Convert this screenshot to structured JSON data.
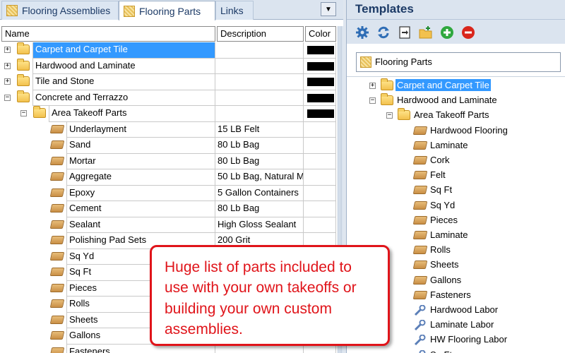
{
  "left_tabs": [
    {
      "label": "Flooring Assemblies",
      "icon": "flooring-pattern-icon"
    },
    {
      "label": "Flooring Parts",
      "icon": "flooring-pattern-icon",
      "active": true
    },
    {
      "label": "Links"
    }
  ],
  "grid": {
    "columns": [
      "Name",
      "Description",
      "Color"
    ],
    "rows": [
      {
        "name": "Carpet and Carpet Tile",
        "description": "",
        "color": "#000000",
        "level": 0,
        "type": "folder",
        "expander": "+",
        "selected": true
      },
      {
        "name": "Hardwood and Laminate",
        "description": "",
        "color": "#000000",
        "level": 0,
        "type": "folder",
        "expander": "+"
      },
      {
        "name": "Tile and Stone",
        "description": "",
        "color": "#000000",
        "level": 0,
        "type": "folder",
        "expander": "+"
      },
      {
        "name": "Concrete and Terrazzo",
        "description": "",
        "color": "#000000",
        "level": 0,
        "type": "folder",
        "expander": "−"
      },
      {
        "name": "Area Takeoff Parts",
        "description": "",
        "color": "#000000",
        "level": 1,
        "type": "folder",
        "expander": "−"
      },
      {
        "name": "Underlayment",
        "description": "15 LB Felt",
        "level": 2,
        "type": "part"
      },
      {
        "name": "Sand",
        "description": "80 Lb Bag",
        "level": 2,
        "type": "part"
      },
      {
        "name": "Mortar",
        "description": "80 Lb Bag",
        "level": 2,
        "type": "part"
      },
      {
        "name": "Aggregate",
        "description": "50 Lb Bag, Natural M",
        "level": 2,
        "type": "part"
      },
      {
        "name": "Epoxy",
        "description": "5 Gallon Containers",
        "level": 2,
        "type": "part"
      },
      {
        "name": "Cement",
        "description": "80 Lb Bag",
        "level": 2,
        "type": "part"
      },
      {
        "name": "Sealant",
        "description": "High Gloss Sealant",
        "level": 2,
        "type": "part"
      },
      {
        "name": "Polishing Pad Sets",
        "description": "200 Grit",
        "level": 2,
        "type": "part"
      },
      {
        "name": "Sq Yd",
        "description": "",
        "level": 2,
        "type": "part"
      },
      {
        "name": "Sq Ft",
        "description": "",
        "level": 2,
        "type": "part"
      },
      {
        "name": "Pieces",
        "description": "",
        "level": 2,
        "type": "part"
      },
      {
        "name": "Rolls",
        "description": "",
        "level": 2,
        "type": "part"
      },
      {
        "name": "Sheets",
        "description": "",
        "level": 2,
        "type": "part"
      },
      {
        "name": "Gallons",
        "description": "",
        "level": 2,
        "type": "part"
      },
      {
        "name": "Fasteners",
        "description": "",
        "level": 2,
        "type": "part"
      }
    ]
  },
  "templates": {
    "title": "Templates",
    "toolbar": [
      "settings-gear-icon",
      "refresh-icon",
      "import-icon",
      "new-folder-icon",
      "add-icon",
      "remove-icon"
    ],
    "selected_template": "Flooring Parts",
    "tree": [
      {
        "label": "Carpet and Carpet Tile",
        "level": 0,
        "type": "folder",
        "expander": "+",
        "selected": true
      },
      {
        "label": "Hardwood and Laminate",
        "level": 0,
        "type": "folder",
        "expander": "−"
      },
      {
        "label": "Area Takeoff Parts",
        "level": 1,
        "type": "folder",
        "expander": "−"
      },
      {
        "label": "Hardwood Flooring",
        "level": 2,
        "type": "part"
      },
      {
        "label": "Laminate",
        "level": 2,
        "type": "part"
      },
      {
        "label": "Cork",
        "level": 2,
        "type": "part"
      },
      {
        "label": "Felt",
        "level": 2,
        "type": "part"
      },
      {
        "label": "Sq Ft",
        "level": 2,
        "type": "part"
      },
      {
        "label": "Sq Yd",
        "level": 2,
        "type": "part"
      },
      {
        "label": "Pieces",
        "level": 2,
        "type": "part"
      },
      {
        "label": "Laminate",
        "level": 2,
        "type": "part"
      },
      {
        "label": "Rolls",
        "level": 2,
        "type": "part"
      },
      {
        "label": "Sheets",
        "level": 2,
        "type": "part"
      },
      {
        "label": "Gallons",
        "level": 2,
        "type": "part"
      },
      {
        "label": "Fasteners",
        "level": 2,
        "type": "part"
      },
      {
        "label": "Hardwood Labor",
        "level": 2,
        "type": "labor"
      },
      {
        "label": "Laminate Labor",
        "level": 2,
        "type": "labor"
      },
      {
        "label": "HW Flooring Labor",
        "level": 2,
        "type": "labor"
      },
      {
        "label": "Sq Ft",
        "level": 2,
        "type": "labor"
      }
    ]
  },
  "callout": {
    "text": "Huge list of parts included to use with your own takeoffs or building your own custom assemblies."
  },
  "colors": {
    "selection": "#3399ff",
    "callout_red": "#e0141a",
    "panel_bg": "#dbe4ef",
    "title_text": "#1c3a66"
  }
}
